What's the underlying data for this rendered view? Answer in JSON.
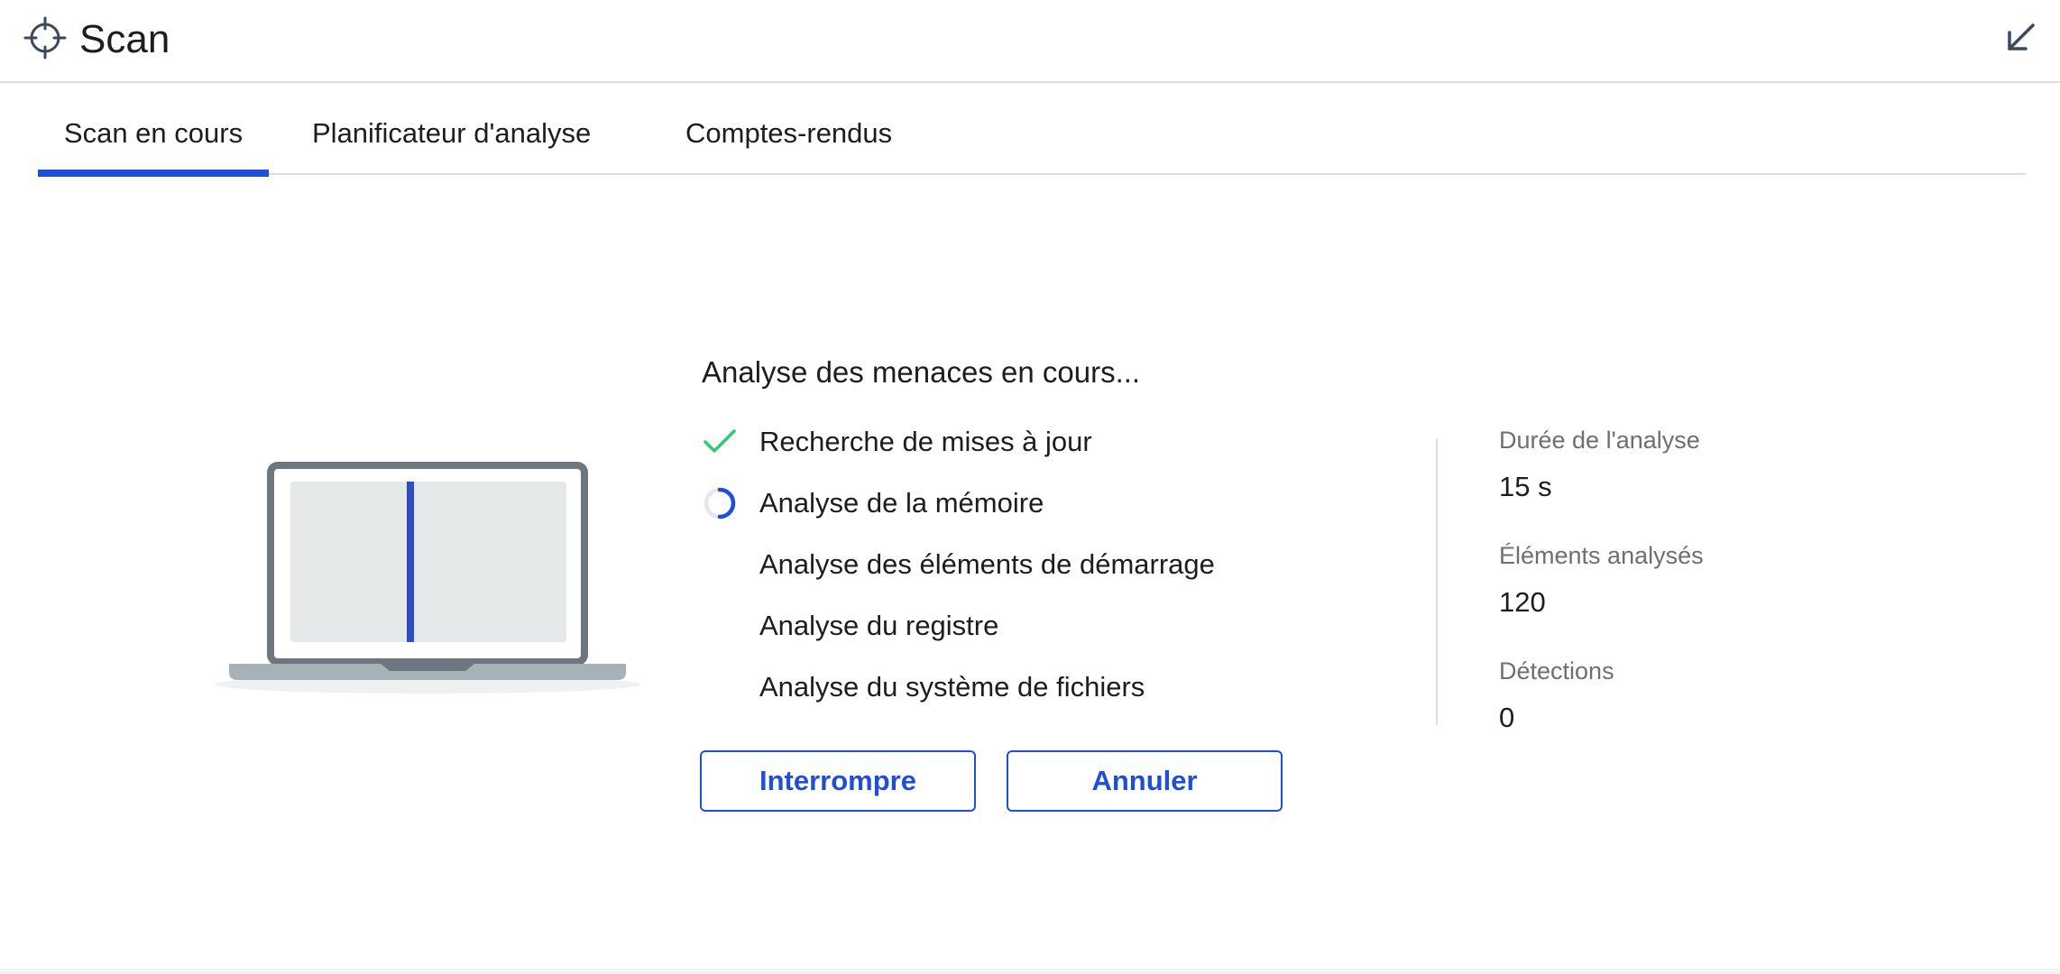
{
  "window": {
    "title": "Scan",
    "icon": "crosshair-icon",
    "minimize_icon": "arrow-down-left-icon"
  },
  "tabs": [
    {
      "label": "Scan en cours",
      "active": true
    },
    {
      "label": "Planificateur d'analyse",
      "active": false
    },
    {
      "label": "Comptes-rendus",
      "active": false
    }
  ],
  "scan": {
    "heading": "Analyse des menaces en cours...",
    "steps": [
      {
        "label": "Recherche de mises à jour",
        "status": "done",
        "icon": "check-icon"
      },
      {
        "label": "Analyse de la mémoire",
        "status": "in-progress",
        "icon": "spinner-icon"
      },
      {
        "label": "Analyse des éléments de démarrage",
        "status": "pending",
        "icon": ""
      },
      {
        "label": "Analyse du registre",
        "status": "pending",
        "icon": ""
      },
      {
        "label": "Analyse du système de fichiers",
        "status": "pending",
        "icon": ""
      }
    ],
    "buttons": {
      "pause": "Interrompre",
      "cancel": "Annuler"
    }
  },
  "stats": [
    {
      "label": "Durée de l'analyse",
      "value": "15 s"
    },
    {
      "label": "Éléments analysés",
      "value": "120"
    },
    {
      "label": "Détections",
      "value": "0"
    }
  ],
  "colors": {
    "accent": "#1f4fd6",
    "success": "#2ecc71",
    "text": "#1d1d1f",
    "muted": "#6e6e73",
    "divider": "#dcdcdc"
  }
}
